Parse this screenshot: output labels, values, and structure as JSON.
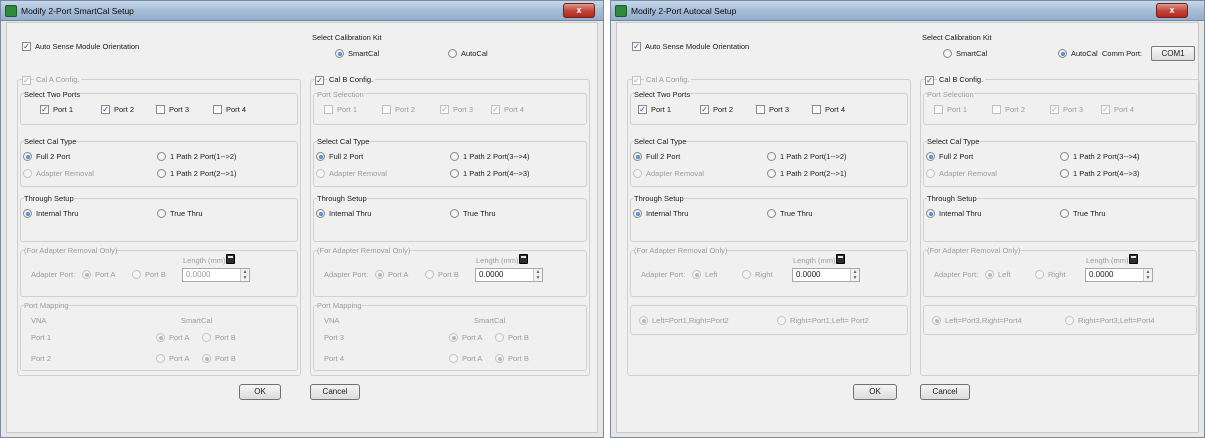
{
  "windows": [
    {
      "title": "Modify 2-Port SmartCal Setup",
      "close_label": "x",
      "auto_sense_label": "Auto Sense Module Orientation",
      "cal_kit": {
        "title": "Select Calibration Kit",
        "option_smartcal": "SmartCal",
        "option_autocal": "AutoCal",
        "selected": "SmartCal"
      },
      "cal_a": {
        "title": "Cal A Config.",
        "ports_title": "Select Two Ports",
        "ports": [
          {
            "label": "Port 1",
            "checked": true
          },
          {
            "label": "Port 2",
            "checked": true
          },
          {
            "label": "Port 3",
            "checked": false
          },
          {
            "label": "Port 4",
            "checked": false
          }
        ],
        "cal_type_title": "Select Cal Type",
        "full_2port": "Full 2 Port",
        "adapter_removal": "Adapter Removal",
        "path_a": "1 Path 2 Port(1-->2)",
        "path_b": "1 Path 2 Port(2-->1)",
        "through_title": "Through Setup",
        "internal_thru": "Internal Thru",
        "true_thru": "True Thru",
        "adapter_title": "(For Adapter Removal Only)",
        "adapter_port_label": "Adapter Port:",
        "adapter_opt1": "Port A",
        "adapter_opt2": "Port B",
        "length_label": "Length (mm)",
        "length_value": "0.0000",
        "mapping_title": "Port Mapping",
        "mapping_col_vna": "VNA",
        "mapping_col_cal": "SmartCal",
        "mapping_rows": [
          {
            "port": "Port 1",
            "opt_a": "Port A",
            "opt_b": "Port B",
            "selected": "A"
          },
          {
            "port": "Port 2",
            "opt_a": "Port A",
            "opt_b": "Port B",
            "selected": "B"
          }
        ]
      },
      "cal_b": {
        "title": "Cal B Config.",
        "ports_title": "Port Selection",
        "ports": [
          {
            "label": "Port 1",
            "checked": false
          },
          {
            "label": "Port 2",
            "checked": false
          },
          {
            "label": "Port 3",
            "checked": true
          },
          {
            "label": "Port 4",
            "checked": true
          }
        ],
        "cal_type_title": "Select Cal Type",
        "full_2port": "Full 2 Port",
        "adapter_removal": "Adapter Removal",
        "path_a": "1 Path 2 Port(3-->4)",
        "path_b": "1 Path 2 Port(4-->3)",
        "through_title": "Through Setup",
        "internal_thru": "Internal Thru",
        "true_thru": "True Thru",
        "adapter_title": "(For Adapter Removal Only)",
        "adapter_port_label": "Adapter Port:",
        "adapter_opt1": "Port A",
        "adapter_opt2": "Port B",
        "length_label": "Length (mm)",
        "length_value": "0.0000",
        "mapping_title": "Port Mapping",
        "mapping_col_vna": "VNA",
        "mapping_col_cal": "SmartCal",
        "mapping_rows": [
          {
            "port": "Port 3",
            "opt_a": "Port A",
            "opt_b": "Port B",
            "selected": "A"
          },
          {
            "port": "Port 4",
            "opt_a": "Port A",
            "opt_b": "Port B",
            "selected": "B"
          }
        ]
      },
      "ok_label": "OK",
      "cancel_label": "Cancel"
    },
    {
      "title": "Modify 2-Port Autocal Setup",
      "close_label": "x",
      "auto_sense_label": "Auto Sense Module Orientation",
      "cal_kit": {
        "title": "Select Calibration Kit",
        "option_smartcal": "SmartCal",
        "option_autocal": "AutoCal",
        "selected": "AutoCal",
        "comm_port_label": "Comm Port:",
        "comm_port_value": "COM1"
      },
      "cal_a": {
        "title": "Cal A Config.",
        "ports_title": "Select Two Ports",
        "ports": [
          {
            "label": "Port 1",
            "checked": true
          },
          {
            "label": "Port 2",
            "checked": true
          },
          {
            "label": "Port 3",
            "checked": false
          },
          {
            "label": "Port 4",
            "checked": false
          }
        ],
        "cal_type_title": "Select Cal Type",
        "full_2port": "Full 2 Port",
        "adapter_removal": "Adapter Removal",
        "path_a": "1 Path 2 Port(1-->2)",
        "path_b": "1 Path 2 Port(2-->1)",
        "through_title": "Through Setup",
        "internal_thru": "Internal Thru",
        "true_thru": "True Thru",
        "adapter_title": "(For Adapter Removal Only)",
        "adapter_port_label": "Adapter Port:",
        "adapter_opt1": "Left",
        "adapter_opt2": "Right",
        "length_label": "Length (mm)",
        "length_value": "0.0000",
        "orient_opt1": "Left=Port1,Right=Port2",
        "orient_opt2": "Right=Port1,Left= Port2"
      },
      "cal_b": {
        "title": "Cal B Config.",
        "ports_title": "Port Selection",
        "ports": [
          {
            "label": "Port 1",
            "checked": false
          },
          {
            "label": "Port 2",
            "checked": false
          },
          {
            "label": "Port 3",
            "checked": true
          },
          {
            "label": "Port 4",
            "checked": true
          }
        ],
        "cal_type_title": "Select Cal Type",
        "full_2port": "Full 2 Port",
        "adapter_removal": "Adapter Removal",
        "path_a": "1 Path 2 Port(3-->4)",
        "path_b": "1 Path 2 Port(4-->3)",
        "through_title": "Through Setup",
        "internal_thru": "Internal Thru",
        "true_thru": "True Thru",
        "adapter_title": "(For Adapter Removal Only)",
        "adapter_port_label": "Adapter Port:",
        "adapter_opt1": "Left",
        "adapter_opt2": "Right",
        "length_label": "Length (mm)",
        "length_value": "0.0000",
        "orient_opt1": "Left=Port3,Right=Port4",
        "orient_opt2": "Right=Port3,Left=Port4"
      },
      "ok_label": "OK",
      "cancel_label": "Cancel"
    }
  ]
}
